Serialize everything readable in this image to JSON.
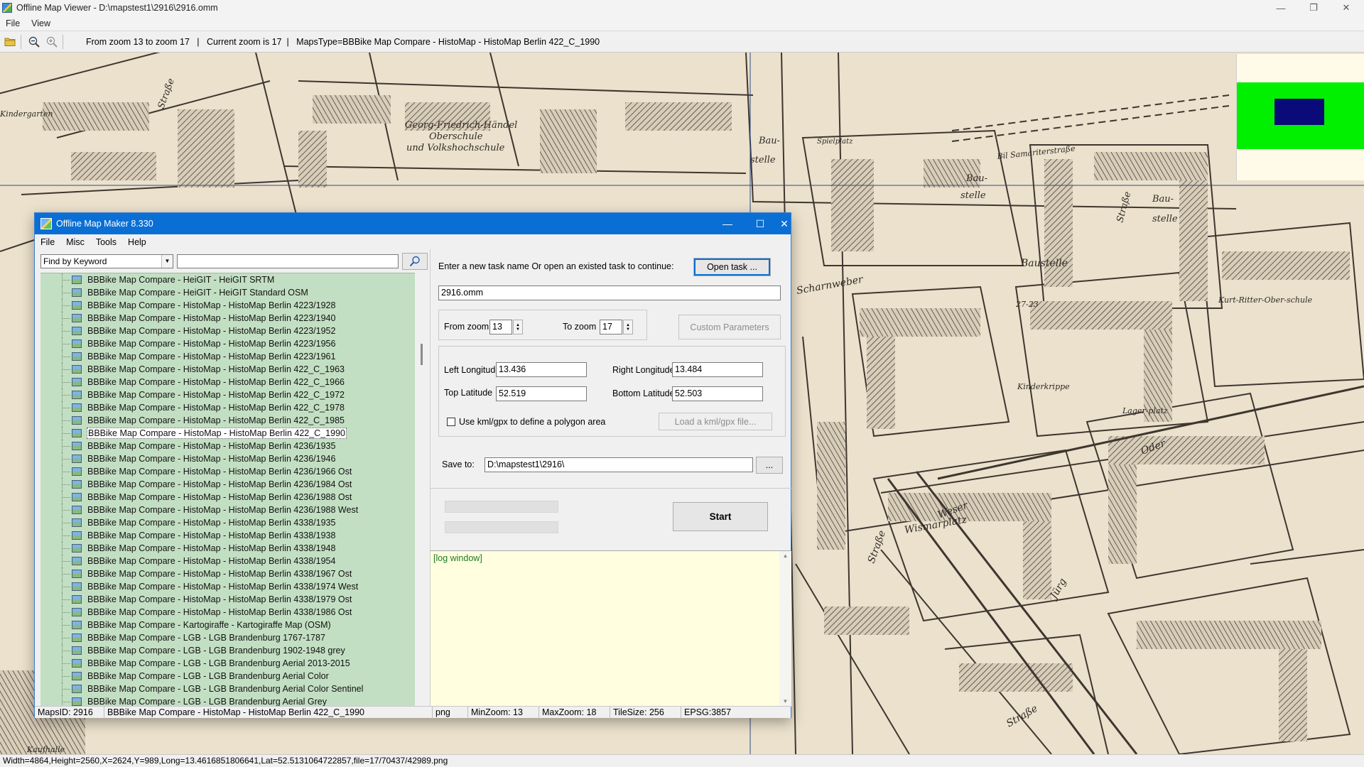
{
  "viewer": {
    "title": "Offline Map Viewer - D:\\mapstest1\\2916\\2916.omm",
    "menu": [
      "File",
      "View"
    ],
    "toolbar_status": "From zoom 13 to zoom 17   |   Current zoom is 17  |   MapsType=BBBike Map Compare - HistoMap - HistoMap Berlin 422_C_1990",
    "statusbar": "Width=4864,Height=2560,X=2624,Y=989,Long=13.4616851806641,Lat=52.5131064722857,file=17/70437/42989.png",
    "window_controls": {
      "minimize": "—",
      "maximize": "❐",
      "close": "✕"
    },
    "map_labels": {
      "label1": "Georg-Friedrich-Händel",
      "label2": "Oberschule",
      "label3": "und Volkshochschule",
      "label4": "Bau-",
      "label5": "stelle",
      "label6": "Spielplatz",
      "label7": "Baustelle",
      "label8": "Scharnweber",
      "label9": "Kinderkrippe",
      "label10": "Kindergarten",
      "label11": "Straße",
      "label12": "Wismarplatz",
      "label13": "Kaufhalle",
      "label14": "Oder",
      "label15": "Weser",
      "label16": "Kurt-Ritter-Ober-schule",
      "label17": "Lager-platz",
      "label18": "Bil Samariterstraße",
      "label19": "27-23",
      "label20": "Jürg"
    },
    "minimap_colors": {
      "background": "#fffbe8",
      "coverage": "#00f000",
      "viewport": "#0a0a78"
    }
  },
  "maker": {
    "title": "Offline Map Maker 8.330",
    "menu": [
      "File",
      "Misc",
      "Tools",
      "Help"
    ],
    "window_controls": {
      "minimize": "—",
      "maximize": "☐",
      "close": "✕"
    },
    "find_mode": "Find by Keyword",
    "search_value": "",
    "tree_items": [
      "BBBike Map Compare - HeiGIT - HeiGIT SRTM",
      "BBBike Map Compare - HeiGIT - HeiGIT Standard OSM",
      "BBBike Map Compare - HistoMap - HistoMap Berlin 4223/1928",
      "BBBike Map Compare - HistoMap - HistoMap Berlin 4223/1940",
      "BBBike Map Compare - HistoMap - HistoMap Berlin 4223/1952",
      "BBBike Map Compare - HistoMap - HistoMap Berlin 4223/1956",
      "BBBike Map Compare - HistoMap - HistoMap Berlin 4223/1961",
      "BBBike Map Compare - HistoMap - HistoMap Berlin 422_C_1963",
      "BBBike Map Compare - HistoMap - HistoMap Berlin 422_C_1966",
      "BBBike Map Compare - HistoMap - HistoMap Berlin 422_C_1972",
      "BBBike Map Compare - HistoMap - HistoMap Berlin 422_C_1978",
      "BBBike Map Compare - HistoMap - HistoMap Berlin 422_C_1985",
      "BBBike Map Compare - HistoMap - HistoMap Berlin 422_C_1990",
      "BBBike Map Compare - HistoMap - HistoMap Berlin 4236/1935",
      "BBBike Map Compare - HistoMap - HistoMap Berlin 4236/1946",
      "BBBike Map Compare - HistoMap - HistoMap Berlin 4236/1966 Ost",
      "BBBike Map Compare - HistoMap - HistoMap Berlin 4236/1984 Ost",
      "BBBike Map Compare - HistoMap - HistoMap Berlin 4236/1988 Ost",
      "BBBike Map Compare - HistoMap - HistoMap Berlin 4236/1988 West",
      "BBBike Map Compare - HistoMap - HistoMap Berlin 4338/1935",
      "BBBike Map Compare - HistoMap - HistoMap Berlin 4338/1938",
      "BBBike Map Compare - HistoMap - HistoMap Berlin 4338/1948",
      "BBBike Map Compare - HistoMap - HistoMap Berlin 4338/1954",
      "BBBike Map Compare - HistoMap - HistoMap Berlin 4338/1967 Ost",
      "BBBike Map Compare - HistoMap - HistoMap Berlin 4338/1974 West",
      "BBBike Map Compare - HistoMap - HistoMap Berlin 4338/1979 Ost",
      "BBBike Map Compare - HistoMap - HistoMap Berlin 4338/1986 Ost",
      "BBBike Map Compare - Kartogiraffe - Kartogiraffe Map (OSM)",
      "BBBike Map Compare - LGB - LGB Brandenburg 1767-1787",
      "BBBike Map Compare - LGB - LGB Brandenburg 1902-1948 grey",
      "BBBike Map Compare - LGB - LGB Brandenburg Aerial 2013-2015",
      "BBBike Map Compare - LGB - LGB Brandenburg Aerial Color",
      "BBBike Map Compare - LGB - LGB Brandenburg Aerial Color Sentinel",
      "BBBike Map Compare - LGB - LGB Brandenburg Aerial Grey"
    ],
    "selected_index": 12,
    "task_prompt": "Enter a new task name Or open an existed task to continue:",
    "open_task_label": "Open task ...",
    "task_name": "2916.omm",
    "from_zoom_label": "From zoom",
    "from_zoom": "13",
    "to_zoom_label": "To zoom",
    "to_zoom": "17",
    "custom_params_label": "Custom Parameters",
    "left_lon_label": "Left Longitude",
    "left_lon": "13.436",
    "right_lon_label": "Right Longitude",
    "right_lon": "13.484",
    "top_lat_label": "Top Latitude",
    "top_lat": "52.519",
    "bottom_lat_label": "Bottom Latitude",
    "bottom_lat": "52.503",
    "kml_label": "Use kml/gpx to define a polygon area",
    "load_kml_label": "Load a kml/gpx file...",
    "save_to_label": "Save to:",
    "save_to": "D:\\mapstest1\\2916\\",
    "browse_label": "...",
    "start_label": "Start",
    "log_text": "[log window]",
    "status": {
      "maps_id": "MapsID: 2916",
      "map_name": "BBBike Map Compare - HistoMap - HistoMap Berlin 422_C_1990",
      "format": "png",
      "min_zoom": "MinZoom: 13",
      "max_zoom": "MaxZoom: 18",
      "tile_size": "TileSize: 256",
      "epsg": "EPSG:3857"
    }
  }
}
